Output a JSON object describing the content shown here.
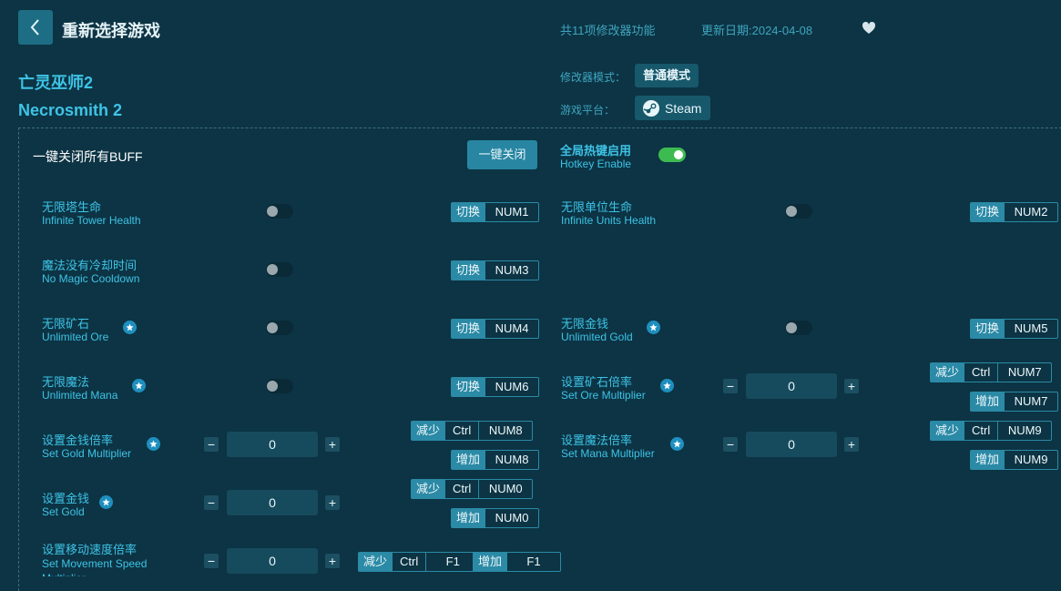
{
  "header": {
    "title": "重新选择游戏",
    "feature_count": "共11项修改器功能",
    "update_date": "更新日期:2024-04-08"
  },
  "game": {
    "name_zh": "亡灵巫师2",
    "name_en": "Necrosmith 2"
  },
  "meta": {
    "mode_label": "修改器模式：",
    "mode_value": "普通模式",
    "platform_label": "游戏平台：",
    "platform_value": "Steam"
  },
  "global": {
    "close_all_label": "一键关闭所有BUFF",
    "close_all_button": "一键关闭",
    "hotkey_zh": "全局热键启用",
    "hotkey_en": "Hotkey Enable",
    "hotkey_enabled": true
  },
  "features": {
    "f1": {
      "zh": "无限塔生命",
      "en": "Infinite Tower Health",
      "act": "切换",
      "key": "NUM1"
    },
    "f2": {
      "zh": "无限单位生命",
      "en": "Infinite Units Health",
      "act": "切换",
      "key": "NUM2"
    },
    "f3": {
      "zh": "魔法没有冷却时间",
      "en": "No Magic Cooldown",
      "act": "切换",
      "key": "NUM3"
    },
    "f4": {
      "zh": "无限矿石",
      "en": "Unlimited Ore",
      "act": "切换",
      "key": "NUM4"
    },
    "f5": {
      "zh": "无限金钱",
      "en": "Unlimited Gold",
      "act": "切换",
      "key": "NUM5"
    },
    "f6": {
      "zh": "无限魔法",
      "en": "Unlimited Mana",
      "act": "切换",
      "key": "NUM6"
    },
    "f7": {
      "zh": "设置矿石倍率",
      "en": "Set Ore Multiplier",
      "value": "0",
      "dec_act": "减少",
      "dec_mod": "Ctrl",
      "dec_key": "NUM7",
      "inc_act": "增加",
      "inc_key": "NUM7"
    },
    "f8": {
      "zh": "设置金钱倍率",
      "en": "Set Gold Multiplier",
      "value": "0",
      "dec_act": "减少",
      "dec_mod": "Ctrl",
      "dec_key": "NUM8",
      "inc_act": "增加",
      "inc_key": "NUM8"
    },
    "f9": {
      "zh": "设置魔法倍率",
      "en": "Set Mana Multiplier",
      "value": "0",
      "dec_act": "减少",
      "dec_mod": "Ctrl",
      "dec_key": "NUM9",
      "inc_act": "增加",
      "inc_key": "NUM9"
    },
    "f10": {
      "zh": "设置金钱",
      "en": "Set Gold",
      "value": "0",
      "dec_act": "减少",
      "dec_mod": "Ctrl",
      "dec_key": "NUM0",
      "inc_act": "增加",
      "inc_key": "NUM0"
    },
    "f11": {
      "zh": "设置移动速度倍率",
      "en": "Set Movement Speed Multiplier",
      "value": "0",
      "dec_act": "减少",
      "dec_mod": "Ctrl",
      "dec_key": "F1",
      "inc_act": "增加",
      "inc_key": "F1"
    }
  },
  "symbols": {
    "minus": "−",
    "plus": "+"
  },
  "colors": {
    "background": "#0c3444",
    "accent": "#3ec3e6",
    "toggle_on": "#3dbb51",
    "key_accent": "#2b8aa6"
  }
}
